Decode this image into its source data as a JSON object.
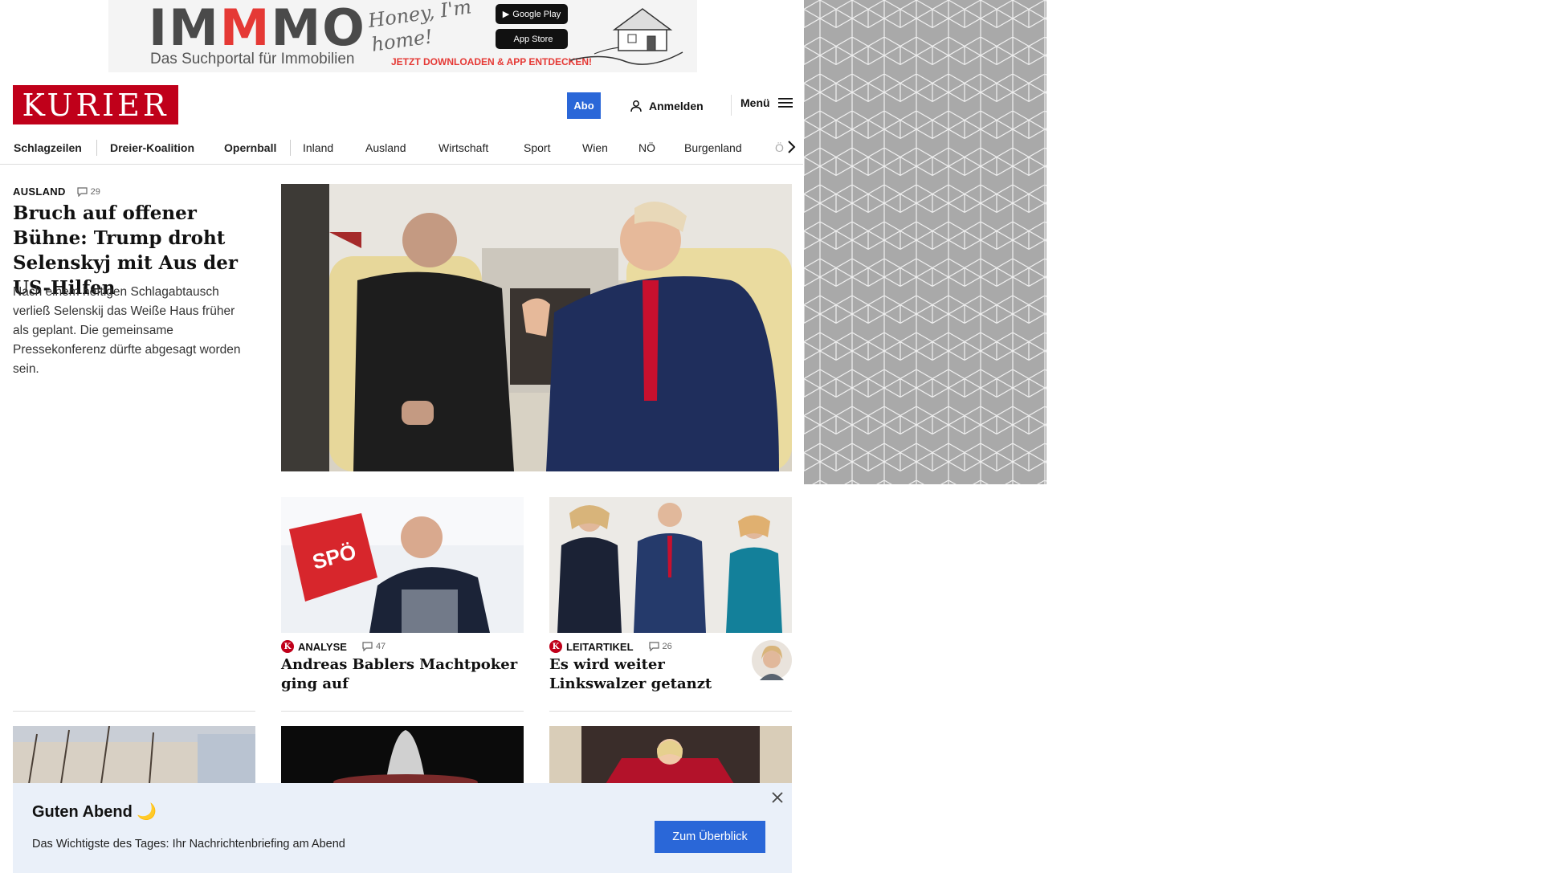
{
  "ad": {
    "brand_prefix": "IM",
    "brand_mid": "M",
    "brand_suffix": "MO",
    "subtitle": "Das Suchportal für Immobilien",
    "script_text": "Honey, I'm home!",
    "google_play_label": "Google Play",
    "app_store_label": "App Store",
    "cta": "JETZT DOWNLOADEN & APP ENTDECKEN!"
  },
  "header": {
    "logo": "KURIER",
    "abo": "Abo",
    "login": "Anmelden",
    "menu": "Menü"
  },
  "nav": {
    "items": [
      "Schlagzeilen",
      "Dreier-Koalition",
      "Opernball",
      "Inland",
      "Ausland",
      "Wirtschaft",
      "Sport",
      "Wien",
      "NÖ",
      "Burgenland",
      "Ö"
    ]
  },
  "lead": {
    "kicker": "AUSLAND",
    "comments": "29",
    "title": "Bruch auf offener Bühne: Trump droht Selenskyj mit Aus der US-Hilfen",
    "text": "Nach einem heftigen Schlagabtausch verließ Selenskij das Weiße Haus früher als geplant. Die gemeinsame Pressekonferenz dürfte abgesagt worden sein."
  },
  "cards": [
    {
      "kicker": "ANALYSE",
      "comments": "47",
      "title": "Andreas Bablers Machtpoker ging auf"
    },
    {
      "kicker": "LEITARTIKEL",
      "comments": "26",
      "title": "Es wird weiter Linkswalzer getanzt"
    }
  ],
  "notification": {
    "title": "Guten Abend 🌙",
    "text": "Das Wichtigste des Tages: Ihr Nachrichtenbriefing am Abend",
    "button": "Zum Überblick"
  },
  "colors": {
    "brand_red": "#c0001a",
    "accent_blue": "#2a67d8",
    "notification_bg": "#eaf0f9",
    "ad_red": "#e53935"
  },
  "icons": [
    "user-icon",
    "hamburger-icon",
    "chevron-right-icon",
    "comment-icon",
    "close-icon",
    "apple-icon",
    "play-icon"
  ]
}
